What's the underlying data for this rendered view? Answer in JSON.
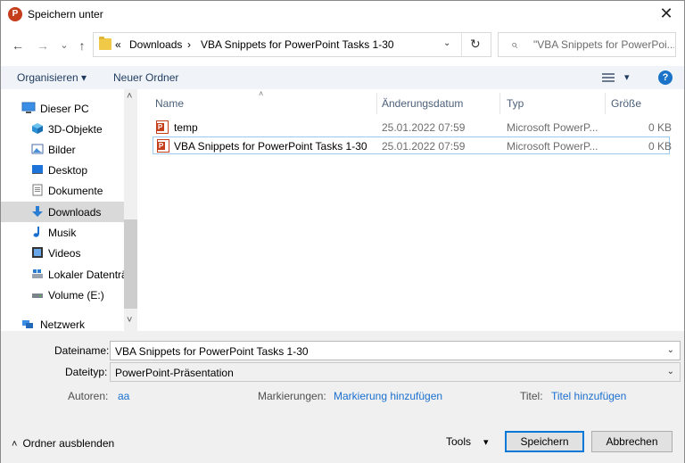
{
  "window": {
    "title": "Speichern unter",
    "close": "✕"
  },
  "nav": {
    "back": "←",
    "forward": "→",
    "recent": "⌄",
    "up": "↑"
  },
  "address": {
    "overflow": "«",
    "crumbs": [
      "Downloads",
      "VBA Snippets for PowerPoint Tasks 1-30"
    ],
    "sep": "›",
    "dropdown": "⌄",
    "refresh": "↻"
  },
  "search": {
    "icon": "⌕",
    "placeholder": "\"VBA Snippets for PowerPoi..."
  },
  "toolbar": {
    "organize": "Organisieren ▾",
    "new_folder": "Neuer Ordner",
    "view_dd": "▾",
    "help": "?"
  },
  "sidebar": {
    "items": [
      {
        "label": "Dieser PC",
        "icon": "computer-icon"
      },
      {
        "label": "3D-Objekte",
        "icon": "cube-icon"
      },
      {
        "label": "Bilder",
        "icon": "pictures-icon"
      },
      {
        "label": "Desktop",
        "icon": "desktop-icon"
      },
      {
        "label": "Dokumente",
        "icon": "documents-icon"
      },
      {
        "label": "Downloads",
        "icon": "download-icon"
      },
      {
        "label": "Musik",
        "icon": "music-icon"
      },
      {
        "label": "Videos",
        "icon": "video-icon"
      },
      {
        "label": "Lokaler Datenträ",
        "icon": "drive-icon"
      },
      {
        "label": "Volume (E:)",
        "icon": "drive-icon"
      },
      {
        "label": "Netzwerk",
        "icon": "network-icon"
      }
    ],
    "scroll_up": "˄",
    "scroll_down": "˅"
  },
  "list": {
    "columns": {
      "name": "Name",
      "date": "Änderungsdatum",
      "type": "Typ",
      "size": "Größe"
    },
    "sort_arrow": "˄",
    "rows": [
      {
        "name": "temp",
        "date": "25.01.2022 07:59",
        "type": "Microsoft PowerP...",
        "size": "0 KB"
      },
      {
        "name": "VBA Snippets for PowerPoint Tasks 1-30",
        "date": "25.01.2022 07:59",
        "type": "Microsoft PowerP...",
        "size": "0 KB"
      }
    ]
  },
  "form": {
    "filename_label": "Dateiname:",
    "filename_value": "VBA Snippets for PowerPoint Tasks 1-30",
    "filetype_label": "Dateityp:",
    "filetype_value": "PowerPoint-Präsentation",
    "authors_label": "Autoren:",
    "authors_value": "aa",
    "tags_label": "Markierungen:",
    "tags_value": "Markierung hinzufügen",
    "title_label": "Titel:",
    "title_value": "Titel hinzufügen",
    "dd": "⌄"
  },
  "footer": {
    "hide_folders": "Ordner ausblenden",
    "hide_arrow": "˄",
    "tools": "Tools",
    "tools_dd": "▾",
    "save": "Speichern",
    "cancel": "Abbrechen"
  }
}
